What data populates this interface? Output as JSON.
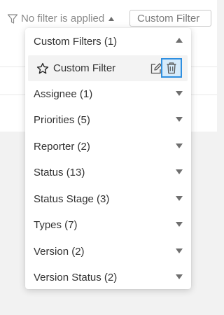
{
  "filterbar": {
    "status_text": "No filter is applied",
    "custom_filter_button": "Custom Filter"
  },
  "dropdown": {
    "custom_filters": {
      "header": "Custom Filters (1)",
      "items": [
        {
          "label": "Custom Filter"
        }
      ]
    },
    "sections": [
      {
        "label": "Assignee (1)"
      },
      {
        "label": "Priorities (5)"
      },
      {
        "label": "Reporter (2)"
      },
      {
        "label": "Status (13)"
      },
      {
        "label": "Status Stage (3)"
      },
      {
        "label": "Types (7)"
      },
      {
        "label": "Version (2)"
      },
      {
        "label": "Version Status (2)"
      }
    ]
  },
  "colors": {
    "highlight_border": "#2f8fe0",
    "highlight_fill": "#d6ebfb",
    "item_background": "#f3f3f3"
  },
  "icons": {
    "filter": "funnel-icon",
    "favorite": "star-outline-icon",
    "edit": "edit-icon",
    "delete": "trash-icon"
  }
}
